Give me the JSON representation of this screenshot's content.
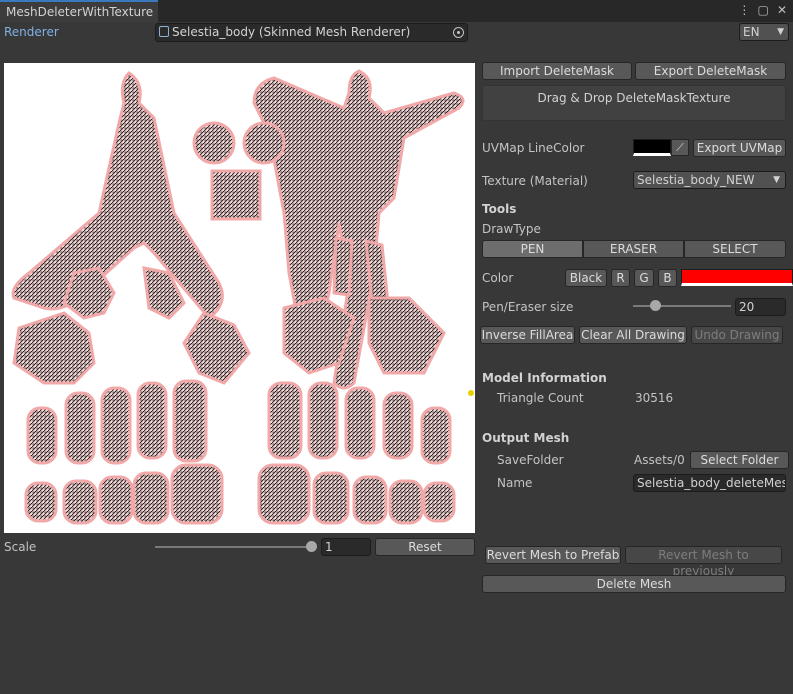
{
  "window": {
    "tab_title": "MeshDeleterWithTexture",
    "icon_menu": "kebab-menu-icon",
    "icon_maximize": "maximize-icon",
    "icon_close": "close-icon"
  },
  "renderer": {
    "label": "Renderer",
    "value": "Selestia_body (Skinned Mesh Renderer)",
    "language": "EN"
  },
  "mask": {
    "import_label": "Import DeleteMask",
    "export_label": "Export DeleteMask",
    "drop_label": "Drag & Drop DeleteMaskTexture"
  },
  "uvmap": {
    "label": "UVMap LineColor",
    "export_label": "Export UVMap",
    "line_color": "#000000"
  },
  "texture": {
    "label": "Texture (Material)",
    "value": "Selestia_body_NEW"
  },
  "tools": {
    "heading": "Tools",
    "drawtype_label": "DrawType",
    "drawtypes": [
      "PEN",
      "ERASER",
      "SELECT"
    ],
    "active_drawtype": "PEN",
    "color_label": "Color",
    "color_buttons": [
      "Black",
      "R",
      "G",
      "B"
    ],
    "pen_color": "#ff0000",
    "size_label": "Pen/Eraser size",
    "size_value": "20",
    "inverse_label": "Inverse FillArea",
    "clear_label": "Clear All Drawing",
    "undo_label": "Undo Drawing"
  },
  "model_info": {
    "heading": "Model Information",
    "triangle_label": "Triangle Count",
    "triangle_value": "30516"
  },
  "output": {
    "heading": "Output Mesh",
    "folder_label": "SaveFolder",
    "folder_value": "Assets/0",
    "folder_button": "Select Folder",
    "name_label": "Name",
    "name_value": "Selestia_body_deleteMesh"
  },
  "scale": {
    "label": "Scale",
    "value": "1",
    "reset_label": "Reset"
  },
  "actions": {
    "revert_prefab": "Revert Mesh to Prefab",
    "revert_previous": "Revert Mesh to previously",
    "delete_mesh": "Delete Mesh"
  }
}
